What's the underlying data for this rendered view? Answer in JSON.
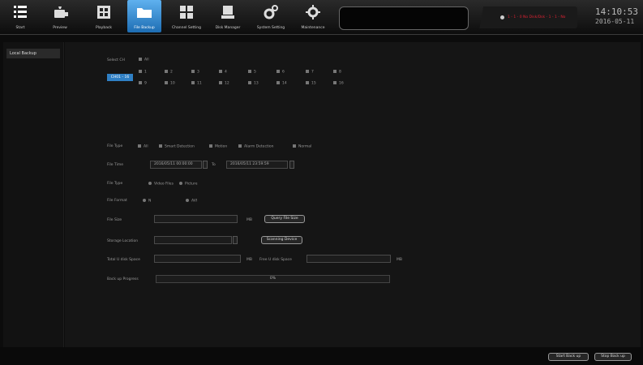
{
  "nav": [
    {
      "label": "Start",
      "icon": "menu-list-icon"
    },
    {
      "label": "Preview",
      "icon": "camera-icon"
    },
    {
      "label": "Playback",
      "icon": "film-icon"
    },
    {
      "label": "File Backup",
      "icon": "folder-icon",
      "active": true
    },
    {
      "label": "Channel Setting",
      "icon": "channel-grid-icon"
    },
    {
      "label": "Disk Manager",
      "icon": "hard-disk-icon"
    },
    {
      "label": "System Setting",
      "icon": "system-gears-icon"
    },
    {
      "label": "Maintenance",
      "icon": "maintenance-gear-icon"
    }
  ],
  "status": {
    "alarm_text": "1 - 1 - 0 No Disk/Dsk - 1 - 1 - No",
    "time": "14:10:53",
    "date": "2016-05-11"
  },
  "sidebar": {
    "items": [
      {
        "label": "Local Backup"
      }
    ]
  },
  "form": {
    "select_ch_label": "Select CH",
    "select_all_label": "All",
    "ch_group_button": "CH01 - 16",
    "channels_row1": [
      "1",
      "2",
      "3",
      "4",
      "5",
      "6",
      "7",
      "8"
    ],
    "channels_row2": [
      "9",
      "10",
      "11",
      "12",
      "13",
      "14",
      "15",
      "16"
    ],
    "file_type_label": "File Type",
    "file_types": [
      "All",
      "Smart Detection",
      "Motion",
      "Alarm Detection",
      "Normal"
    ],
    "file_time_label": "File Time",
    "time_from": "2016/05/11 00:00:00",
    "time_to_label": "To",
    "time_to": "2016/05/11 23:59:59",
    "file_type2_label": "File Type",
    "file_type2_options": [
      "Video Files",
      "Picture"
    ],
    "file_format_label": "File Format",
    "file_formats": [
      "N",
      "AVI"
    ],
    "file_size_label": "File Size",
    "file_size_unit": "MB",
    "query_button": "Query File Size",
    "storage_label": "Storage Location",
    "scan_button": "Scanning Device",
    "total_space_label": "Total U disk Space",
    "total_space_unit": "MB",
    "free_space_label": "Free U disk Space",
    "free_space_unit": "MB",
    "progress_label": "Back up Progress",
    "progress_text": "0%",
    "progress_value": 0
  },
  "footer": {
    "start_button": "Start Back up",
    "stop_button": "Stop Back up"
  },
  "colors": {
    "active_tab": "#3b8fd6",
    "alarm_text": "#dd2233",
    "background": "#151515"
  }
}
